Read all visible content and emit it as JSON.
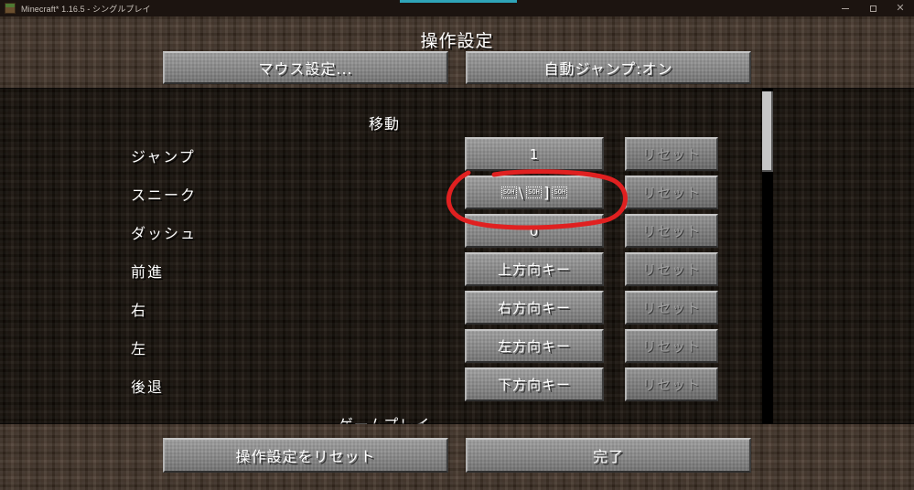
{
  "window": {
    "title": "Minecraft* 1.16.5 - シングルプレイ",
    "icon": "minecraft-grass-block-icon",
    "controls": {
      "minimize": "−",
      "maximize": "□",
      "close": "✕"
    }
  },
  "screen": {
    "title": "操作設定"
  },
  "header_buttons": {
    "mouse_settings": "マウス設定...",
    "auto_jump": "自動ジャンプ:オン"
  },
  "sections": [
    {
      "name": "移動"
    },
    {
      "name": "ゲームプレイ"
    }
  ],
  "bindings": [
    {
      "action": "ジャンプ",
      "key": "1",
      "key_type": "text",
      "reset": "リセット",
      "reset_disabled": true
    },
    {
      "action": "スニーク",
      "key": "",
      "key_type": "control",
      "reset": "リセット",
      "reset_disabled": true,
      "key_glyphs": [
        {
          "kind": "box",
          "label": "SOH"
        },
        {
          "kind": "char",
          "label": "\\"
        },
        {
          "kind": "box",
          "label": "SOH"
        },
        {
          "kind": "char",
          "label": "]"
        },
        {
          "kind": "box",
          "label": "SOH"
        }
      ]
    },
    {
      "action": "ダッシュ",
      "key": "0",
      "key_type": "text",
      "reset": "リセット",
      "reset_disabled": true
    },
    {
      "action": "前進",
      "key": "上方向キー",
      "key_type": "text",
      "reset": "リセット",
      "reset_disabled": true
    },
    {
      "action": "右",
      "key": "右方向キー",
      "key_type": "text",
      "reset": "リセット",
      "reset_disabled": true
    },
    {
      "action": "左",
      "key": "左方向キー",
      "key_type": "text",
      "reset": "リセット",
      "reset_disabled": true
    },
    {
      "action": "後退",
      "key": "下方向キー",
      "key_type": "text",
      "reset": "リセット",
      "reset_disabled": true
    }
  ],
  "footer_buttons": {
    "reset_controls": "操作設定をリセット",
    "done": "完了"
  },
  "annotation": {
    "shape": "hand-drawn-ellipse",
    "color": "#e02020",
    "target": "スニーク"
  },
  "scrollbar": {
    "position": "top"
  }
}
